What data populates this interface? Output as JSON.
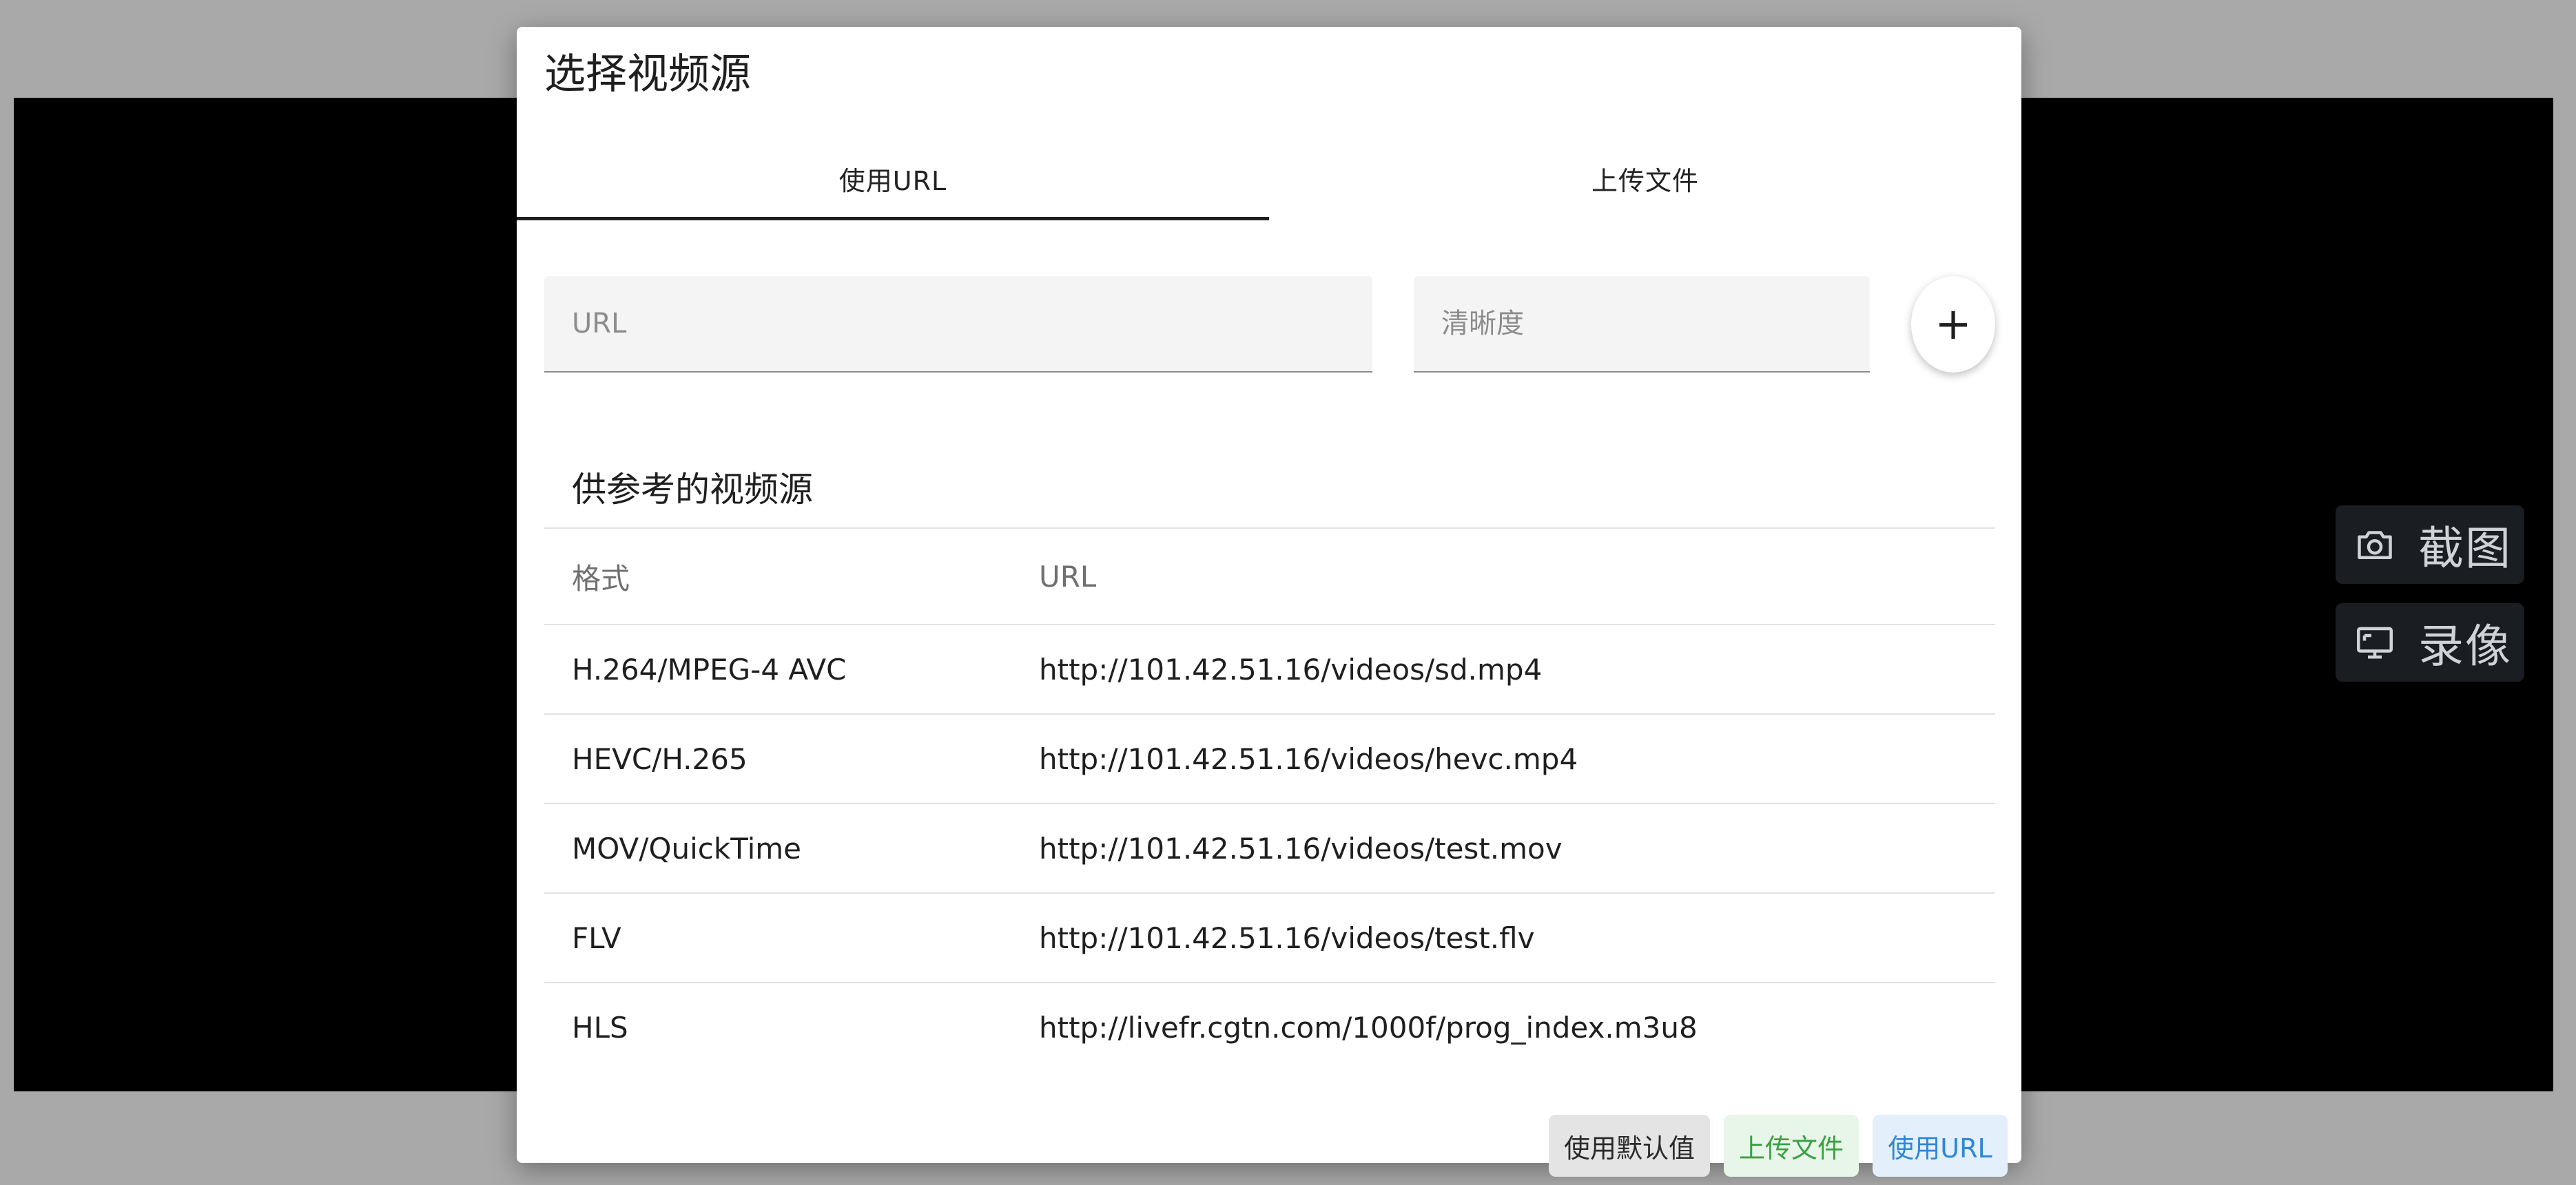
{
  "background": {
    "player_color": "#000000",
    "overlay_color": "#a9a9a9"
  },
  "side_actions": {
    "screenshot_label": "截图",
    "screenshot_icon": "camera-icon",
    "record_label": "录像",
    "record_icon": "screen-record-icon"
  },
  "dialog": {
    "title": "选择视频源",
    "tabs": [
      {
        "label": "使用URL",
        "active": true
      },
      {
        "label": "上传文件",
        "active": false
      }
    ],
    "url_input": {
      "placeholder": "URL",
      "value": ""
    },
    "quality_input": {
      "placeholder": "清晰度",
      "value": ""
    },
    "add_button": {
      "label": "+",
      "icon": "plus-icon"
    },
    "reference": {
      "title": "供参考的视频源",
      "columns": [
        "格式",
        "URL"
      ],
      "rows": [
        {
          "format": "H.264/MPEG-4 AVC",
          "url": "http://101.42.51.16/videos/sd.mp4"
        },
        {
          "format": "HEVC/H.265",
          "url": "http://101.42.51.16/videos/hevc.mp4"
        },
        {
          "format": "MOV/QuickTime",
          "url": "http://101.42.51.16/videos/test.mov"
        },
        {
          "format": "FLV",
          "url": "http://101.42.51.16/videos/test.flv"
        },
        {
          "format": "HLS",
          "url": "http://livefr.cgtn.com/1000f/prog_index.m3u8"
        }
      ]
    },
    "footer": {
      "default_label": "使用默认值",
      "upload_label": "上传文件",
      "url_label": "使用URL",
      "upload_color": "#3aa043",
      "url_color": "#2f86d6"
    }
  }
}
